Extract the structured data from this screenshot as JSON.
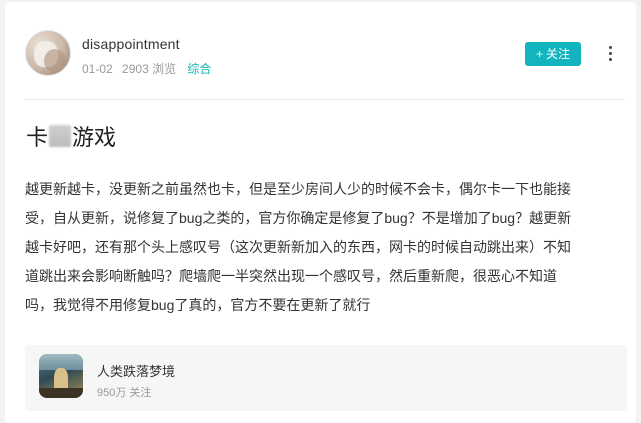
{
  "author": {
    "username": "disappointment",
    "date": "01-02",
    "views": "2903 浏览",
    "category": "综合"
  },
  "actions": {
    "follow_plus": "+",
    "follow_label": "关注",
    "more_icon": "more-vertical-icon"
  },
  "post": {
    "title_prefix": "卡",
    "title_suffix": "游戏",
    "body": "越更新越卡，没更新之前虽然也卡，但是至少房间人少的时候不会卡，偶尔卡一下也能接\n受，自从更新，说修复了bug之类的，官方你确定是修复了bug？不是增加了bug？越更新\n越卡好吧，还有那个头上感叹号（这次更新新加入的东西，网卡的时候自动跳出来）不知\n道跳出来会影响断触吗？爬墙爬一半突然出现一个感叹号，然后重新爬，很恶心不知道\n吗，我觉得不用修复bug了真的，官方不要在更新了就行"
  },
  "game": {
    "name": "人类跌落梦境",
    "followers": "950万 关注"
  },
  "colors": {
    "accent": "#14b4be",
    "page_bg": "#f2f3f5",
    "card_bg": "#ffffff"
  }
}
